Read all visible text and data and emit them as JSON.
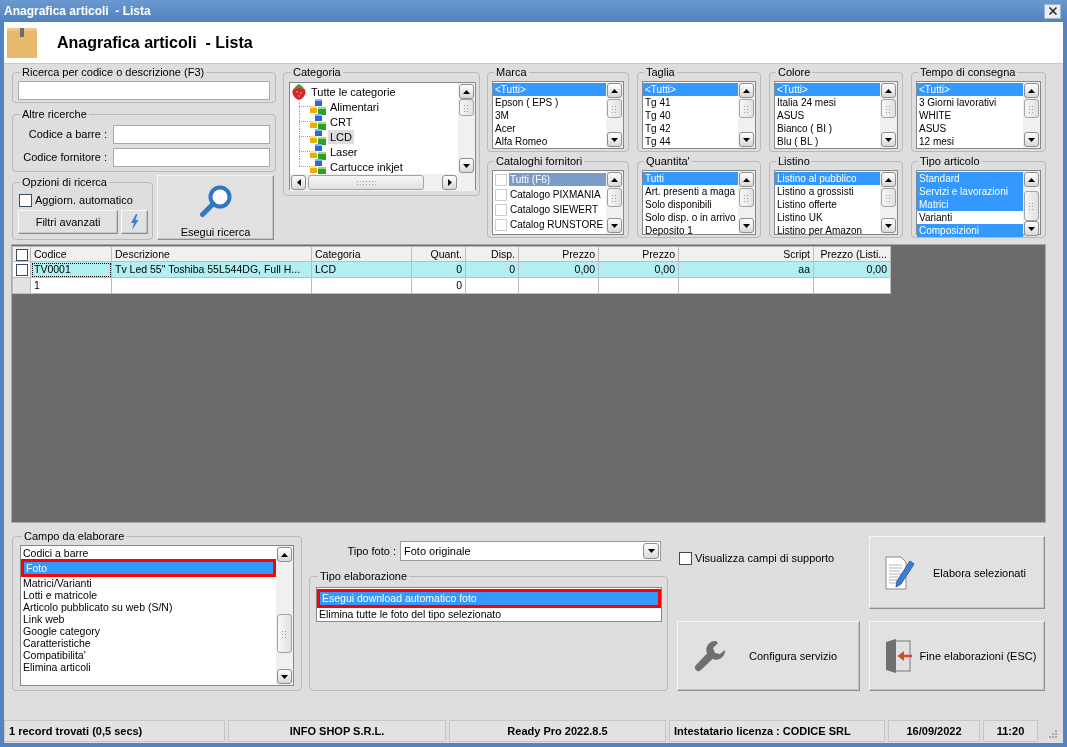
{
  "window": {
    "title": "Anagrafica articoli  - Lista"
  },
  "header": {
    "title": "Anagrafica articoli  - Lista"
  },
  "search": {
    "label": "Ricerca per codice o descrizione (F3)"
  },
  "other_searches": {
    "label": "Altre ricerche",
    "fields": [
      {
        "label": "Codice a barre :"
      },
      {
        "label": "Codice fornitore :"
      }
    ]
  },
  "search_options": {
    "label": "Opzioni di ricerca",
    "auto_update": {
      "label": "Aggiorn. automatico",
      "checked": false
    },
    "advanced_filters_button": {
      "label": "Filtri avanzati"
    }
  },
  "run_search_button": {
    "label": "Esegui ricerca"
  },
  "category": {
    "label": "Categoria",
    "tree": [
      {
        "label": "Tutte le categorie",
        "selected": false,
        "children": [
          {
            "label": "Alimentari",
            "selected": false
          },
          {
            "label": "CRT",
            "selected": false
          },
          {
            "label": "LCD",
            "selected": true
          },
          {
            "label": "Laser",
            "selected": false
          },
          {
            "label": "Cartucce inkjet",
            "selected": false
          }
        ]
      }
    ]
  },
  "filters": [
    {
      "label": "Marca",
      "kind": "list",
      "items": [
        {
          "label": "<Tutti>",
          "selected": true
        },
        {
          "label": "Epson ( EPS )",
          "selected": false
        },
        {
          "label": "3M",
          "selected": false
        },
        {
          "label": "Acer",
          "selected": false
        },
        {
          "label": "Alfa Romeo",
          "selected": false
        }
      ]
    },
    {
      "label": "Taglia",
      "kind": "list",
      "items": [
        {
          "label": "<Tutti>",
          "selected": true
        },
        {
          "label": "Tg 41",
          "selected": false
        },
        {
          "label": "Tg 40",
          "selected": false
        },
        {
          "label": "Tg 42",
          "selected": false
        },
        {
          "label": "Tg 44",
          "selected": false
        }
      ]
    },
    {
      "label": "Colore",
      "kind": "list",
      "items": [
        {
          "label": "<Tutti>",
          "selected": true
        },
        {
          "label": "Italia 24 mesi",
          "selected": false
        },
        {
          "label": "ASUS",
          "selected": false
        },
        {
          "label": "Bianco ( BI )",
          "selected": false
        },
        {
          "label": "Blu ( BL )",
          "selected": false
        }
      ]
    },
    {
      "label": "Tempo di consegna",
      "kind": "list",
      "items": [
        {
          "label": "<Tutti>",
          "selected": true
        },
        {
          "label": "3 Giorni lavorativi",
          "selected": false
        },
        {
          "label": "WHITE",
          "selected": false
        },
        {
          "label": "ASUS",
          "selected": false
        },
        {
          "label": "12 mesi",
          "selected": false
        }
      ]
    },
    {
      "label": "Cataloghi fornitori",
      "kind": "checklist",
      "items": [
        {
          "label": "Tutti (F6)",
          "selected": true,
          "checked": false
        },
        {
          "label": "Catalogo PIXMANIA",
          "selected": false,
          "checked": false
        },
        {
          "label": "Catalogo SIEWERT",
          "selected": false,
          "checked": false
        },
        {
          "label": "Catalog RUNSTORE",
          "selected": false,
          "checked": false
        }
      ]
    },
    {
      "label": "Quantita'",
      "kind": "list",
      "items": [
        {
          "label": "Tutti",
          "selected": true
        },
        {
          "label": "Art. presenti a maga",
          "selected": false
        },
        {
          "label": "Solo disponibili",
          "selected": false
        },
        {
          "label": "Solo disp. o in arrivo",
          "selected": false
        },
        {
          "label": "Deposito 1",
          "selected": false
        }
      ]
    },
    {
      "label": "Listino",
      "kind": "list",
      "items": [
        {
          "label": "Listino al pubblico",
          "selected": true
        },
        {
          "label": "Listino a grossisti",
          "selected": false
        },
        {
          "label": "Listino offerte",
          "selected": false
        },
        {
          "label": "Listino UK",
          "selected": false
        },
        {
          "label": "Listino per Amazon",
          "selected": false
        }
      ]
    },
    {
      "label": "Tipo articolo",
      "kind": "list",
      "items": [
        {
          "label": "Standard",
          "selected": true
        },
        {
          "label": "Servizi e lavorazioni",
          "selected": true
        },
        {
          "label": "Matrici",
          "selected": true
        },
        {
          "label": "Varianti",
          "selected": false
        },
        {
          "label": "Composizioni",
          "selected": true
        }
      ]
    }
  ],
  "table": {
    "header_checked": false,
    "columns": [
      {
        "label": "Codice",
        "kind": "text"
      },
      {
        "label": "Descrizione",
        "kind": "text"
      },
      {
        "label": "Categoria",
        "kind": "text"
      },
      {
        "label": "Quant.",
        "kind": "number"
      },
      {
        "label": "Disp.",
        "kind": "number"
      },
      {
        "label": "Prezzo",
        "kind": "number"
      },
      {
        "label": "Prezzo",
        "kind": "number"
      },
      {
        "label": "Script",
        "kind": "number"
      },
      {
        "label": "Prezzo (Listi...",
        "kind": "number"
      }
    ],
    "rows": [
      {
        "kind": "record",
        "checked": false,
        "selected": true,
        "focused": true,
        "cells": [
          "TV0001",
          "Tv Led 55\" Toshiba 55L544DG, Full H...",
          "LCD",
          "0",
          "0",
          "0,00",
          "0,00",
          "aa",
          "0,00"
        ]
      },
      {
        "kind": "summary",
        "selected": false,
        "focused": false,
        "cells": [
          "1",
          null,
          null,
          "0",
          null,
          null,
          null,
          null,
          null
        ]
      }
    ]
  },
  "processing": {
    "field": {
      "label": "Campo da elaborare",
      "items": [
        {
          "label": "Codici a barre",
          "selected": false,
          "highlighted": false
        },
        {
          "label": "Foto",
          "selected": true,
          "highlighted": true
        },
        {
          "label": "Matrici/Varianti",
          "selected": false,
          "highlighted": false
        },
        {
          "label": "Lotti e matricole",
          "selected": false,
          "highlighted": false
        },
        {
          "label": "Articolo pubblicato su web (S/N)",
          "selected": false,
          "highlighted": false
        },
        {
          "label": "Link web",
          "selected": false,
          "highlighted": false
        },
        {
          "label": "Google category",
          "selected": false,
          "highlighted": false
        },
        {
          "label": "Caratteristiche",
          "selected": false,
          "highlighted": false
        },
        {
          "label": "Compatibilita'",
          "selected": false,
          "highlighted": false
        },
        {
          "label": "Elimina articoli",
          "selected": false,
          "highlighted": false
        }
      ]
    },
    "photo_type": {
      "label": "Tipo foto :",
      "value": "Foto originale"
    },
    "mode": {
      "label": "Tipo elaborazione",
      "items": [
        {
          "label": "Esegui download automatico foto",
          "selected": true,
          "highlighted": true
        },
        {
          "label": "Elimina tutte le foto del tipo selezionato",
          "selected": false,
          "highlighted": false
        }
      ]
    },
    "show_support_fields": {
      "label": "Visualizza campi di supporto",
      "checked": false
    },
    "process_selected_button": {
      "label": "Elabora selezionati"
    },
    "configure_service_button": {
      "label": "Configura servizio"
    },
    "end_processing_button": {
      "label": "Fine elaborazioni (ESC)"
    }
  },
  "status_bar": [
    "1 record trovati (0,5 secs)",
    "INFO SHOP S.R.L.",
    "Ready Pro 2022.8.5",
    "Intestatario licenza : CODICE SRL",
    "16/09/2022",
    "11:20"
  ]
}
